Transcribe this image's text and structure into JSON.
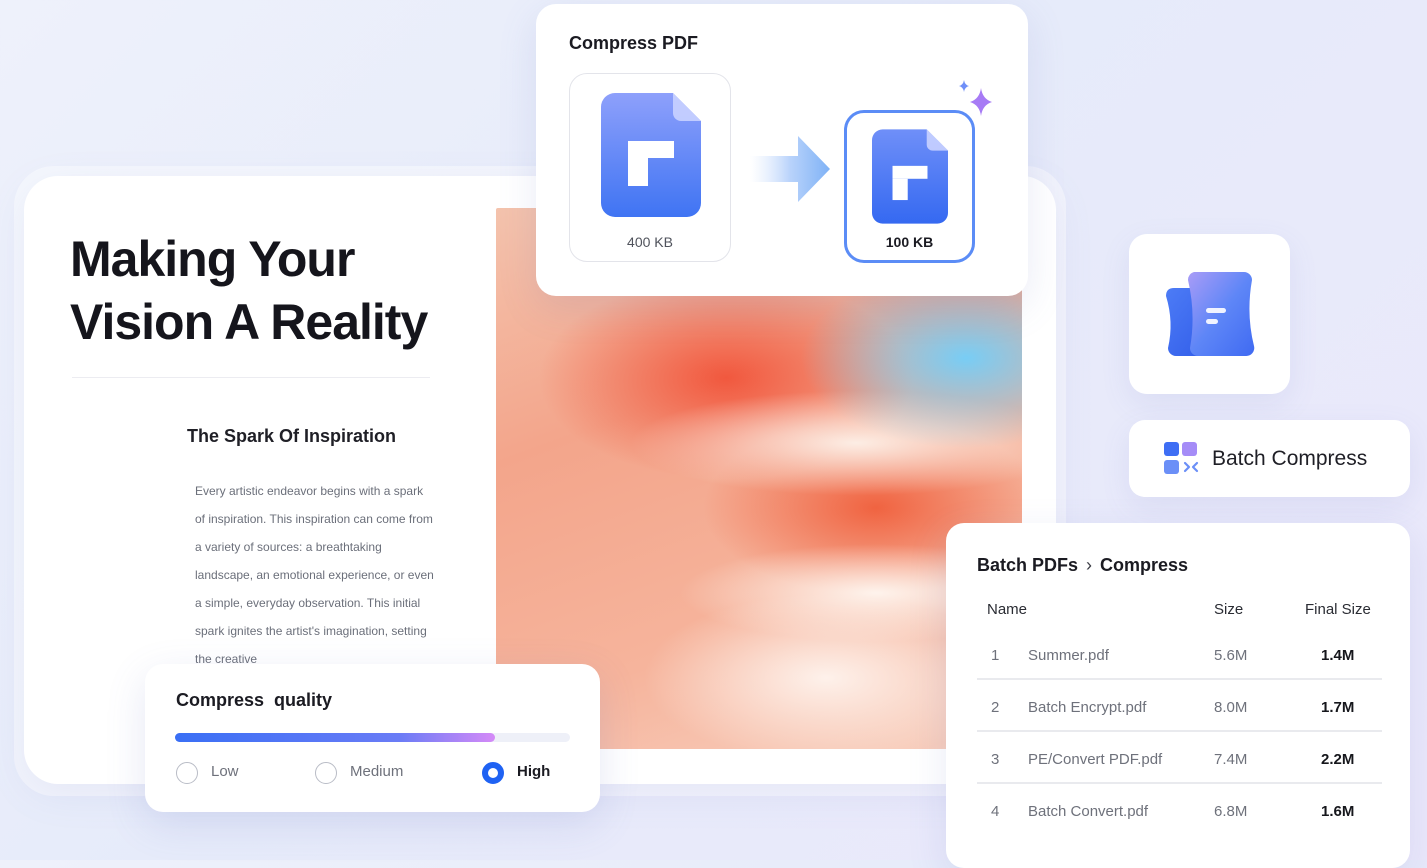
{
  "document": {
    "title_line1": "Making Your",
    "title_line2": "Vision A Reality",
    "subtitle": "The Spark Of Inspiration",
    "body": "Every artistic endeavor begins with a spark of inspiration. This inspiration can come from a variety of sources: a breathtaking landscape, an emotional experience, or even a simple, everyday observation. This initial spark ignites the artist's imagination, setting the creative"
  },
  "compress_pdf": {
    "title": "Compress PDF",
    "before_size": "400 KB",
    "after_size": "100 KB"
  },
  "batch_compress": {
    "label": "Batch Compress"
  },
  "batch_table": {
    "breadcrumb_parent": "Batch PDFs",
    "breadcrumb_separator": "›",
    "breadcrumb_current": "Compress",
    "columns": {
      "name": "Name",
      "size": "Size",
      "final_size": "Final Size"
    },
    "rows": [
      {
        "index": "1",
        "name": "Summer.pdf",
        "size": "5.6M",
        "final_size": "1.4M"
      },
      {
        "index": "2",
        "name": "Batch Encrypt.pdf",
        "size": "8.0M",
        "final_size": "1.7M"
      },
      {
        "index": "3",
        "name": "PE/Convert PDF.pdf",
        "size": "7.4M",
        "final_size": "2.2M"
      },
      {
        "index": "4",
        "name": "Batch Convert.pdf",
        "size": "6.8M",
        "final_size": "1.6M"
      }
    ]
  },
  "compress_quality": {
    "title": "Compress  quality",
    "level_fraction": 0.81,
    "options": [
      {
        "label": "Low",
        "selected": false
      },
      {
        "label": "Medium",
        "selected": false
      },
      {
        "label": "High",
        "selected": true
      }
    ]
  },
  "colors": {
    "accent": "#1f62f3",
    "file_icon": "#4f7cf6",
    "sparkle": "#a77bf5"
  },
  "icons": {
    "pdf_file": "pdf-file-icon",
    "arrow": "arrow-right-icon",
    "sparkle": "sparkle-icon",
    "app": "pdf-app-logo-icon",
    "batch": "batch-grid-icon"
  }
}
